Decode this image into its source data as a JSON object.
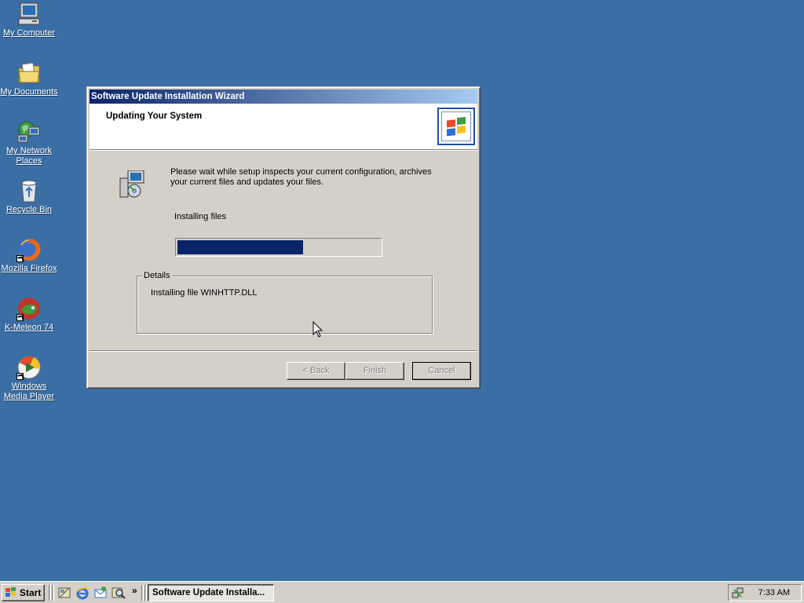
{
  "desktop": {
    "icons": [
      {
        "label": "My Computer",
        "icon": "my-computer-icon"
      },
      {
        "label": "My Documents",
        "icon": "my-documents-icon"
      },
      {
        "label_line1": "My Network",
        "label_line2": "Places",
        "icon": "network-places-icon"
      },
      {
        "label": "Recycle Bin",
        "icon": "recycle-bin-icon"
      },
      {
        "label": "Mozilla Firefox",
        "icon": "firefox-icon"
      },
      {
        "label": "K-Meleon 74",
        "icon": "k-meleon-icon"
      },
      {
        "label_line1": "Windows",
        "label_line2": "Media Player",
        "icon": "media-player-icon"
      }
    ],
    "background_color": "#3A6EA5"
  },
  "wizard": {
    "title": "Software Update Installation Wizard",
    "header_title": "Updating Your System",
    "intro_text": "Please wait while setup inspects your current configuration, archives your current files and updates your files.",
    "progress_label": "Installing files",
    "progress_fraction": 0.62,
    "details_legend": "Details",
    "details_text": "Installing file WINHTTP.DLL",
    "buttons": {
      "back": "< Back",
      "finish": "Finish",
      "cancel": "Cancel"
    },
    "accent_color": "#0A246A"
  },
  "taskbar": {
    "start_label": "Start",
    "quick_launch": [
      "show-desktop-icon",
      "internet-explorer-icon",
      "outlook-express-icon",
      "search-icon"
    ],
    "overflow_label": "»",
    "task_button_label": "Software Update Installa...",
    "clock": "7:33 AM"
  }
}
